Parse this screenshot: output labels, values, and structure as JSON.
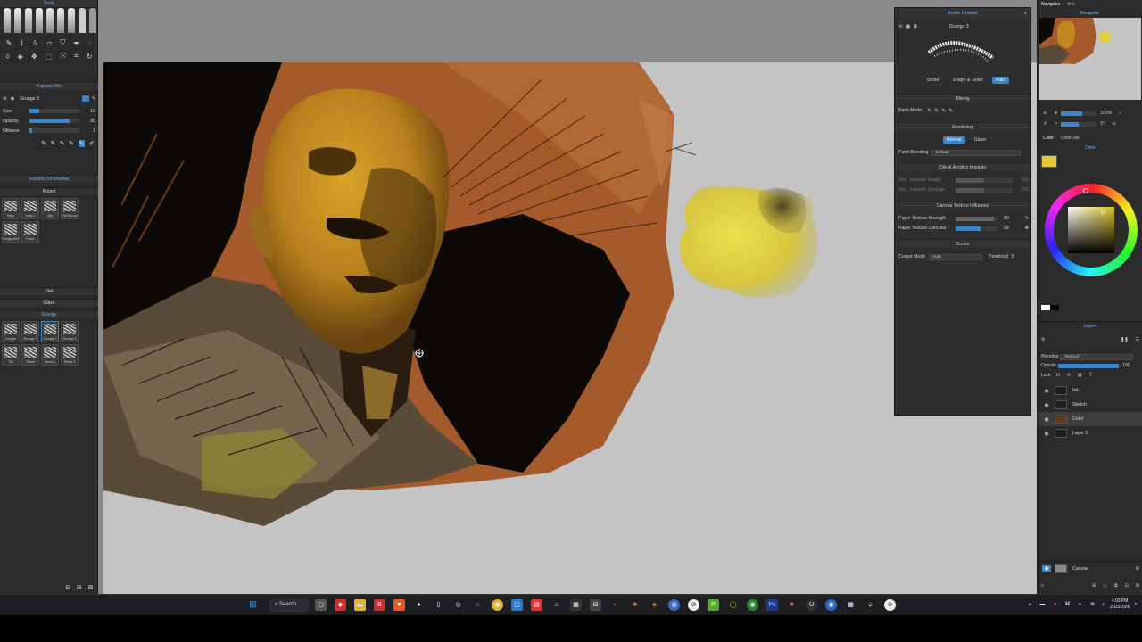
{
  "left_panel": {
    "tools_title": "Tools",
    "express_oils_title": "Express Oils",
    "current_brush": "Grunge 3",
    "size_label": "Size",
    "size_value": "19",
    "opacity_label": "Opacity",
    "opacity_value": "80",
    "oiliness_label": "Oiliness",
    "oiliness_value": "1",
    "brushes_title": "Express Oil Brushes",
    "round_label": "Round",
    "round_brushes": [
      "Hairy",
      "Hairy 2",
      "Oily",
      "Fat Round",
      "Rough Wet",
      "Paper"
    ],
    "flat_label": "Flat",
    "glaze_label": "Glaze",
    "grunge_label": "Grunge",
    "grunge_brushes": [
      "Grunge",
      "Grunge 2",
      "Grunge 3",
      "Grunge 4",
      "Gill",
      "Shred",
      "Shred 2",
      "Shred 3"
    ]
  },
  "brush_creator": {
    "title": "Brush Creator",
    "brush_name": "Grunge 3",
    "tabs": [
      "Stroke",
      "Shape & Grain",
      "Paint"
    ],
    "active_tab": "Paint",
    "mixing_label": "Mixing",
    "paint_mode_label": "Paint Mode",
    "rendering_label": "Rendering",
    "render_normal": "Normal",
    "render_glaze": "Glaze",
    "paint_blending_label": "Paint Blending",
    "paint_blending_value": "Default",
    "impasto_label": "Oils & Acrylics Impasto",
    "max_impasto_height": "Max. Impasto Height",
    "max_impasto_height_value": "100",
    "max_impasto_smudge": "Max. Impasto Smudge",
    "max_impasto_smudge_value": "100",
    "canvas_texture_label": "Canvas Texture Influence",
    "paper_strength_label": "Paper Texture Strength",
    "paper_strength_value": "90",
    "paper_contrast_label": "Paper Texture Contrast",
    "paper_contrast_value": "58",
    "cursor_section": "Cursor",
    "cursor_mode_label": "Cursor Mode",
    "cursor_mode_value": "Auto",
    "threshold_label": "Threshold",
    "threshold_value": "3"
  },
  "right_panel": {
    "tabs_top": [
      "Navigator",
      "Info"
    ],
    "navigator_title": "Navigator",
    "zoom_value": "100%",
    "rotation_value": "0°",
    "color_tabs": [
      "Color",
      "Color Set"
    ],
    "color_title": "Color",
    "current_color": "#e2c93a",
    "layers_title": "Layers",
    "blending_label": "Blending",
    "blending_value": "Normal",
    "opacity_label": "Opacity",
    "opacity_value": "100",
    "lock_label": "Lock",
    "layers": [
      {
        "name": "Ink"
      },
      {
        "name": "Sketch"
      },
      {
        "name": "Color"
      },
      {
        "name": "Layer 5"
      }
    ],
    "selected_layer": "Color",
    "canvas_layer": "Canvas"
  },
  "taskbar": {
    "search_label": "Search",
    "time": "4:03 PM",
    "date": "2/15/2026"
  }
}
